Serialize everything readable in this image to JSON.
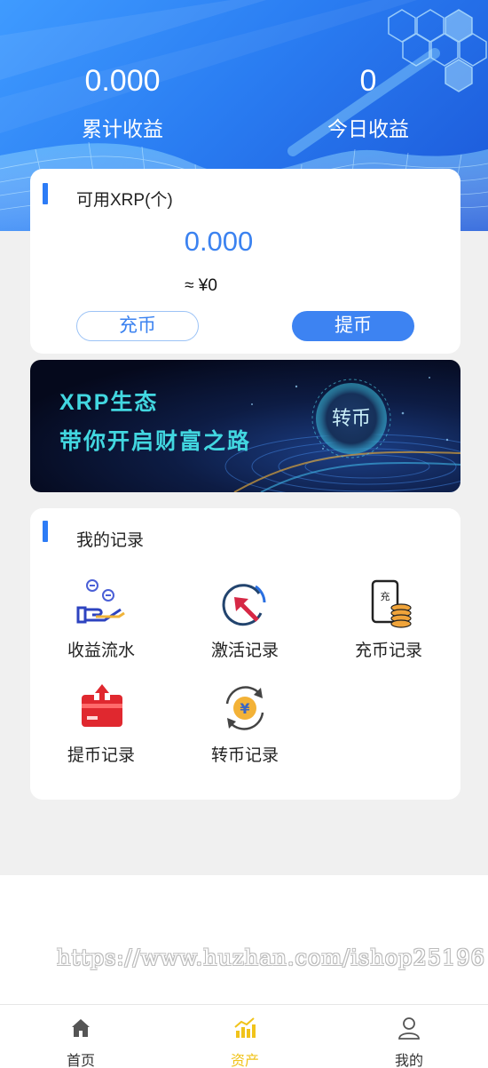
{
  "stats": {
    "total_value": "0.000",
    "total_label": "累计收益",
    "today_value": "0",
    "today_label": "今日收益"
  },
  "wallet": {
    "title": "可用XRP(个)",
    "amount": "0.000",
    "approx": "≈ ¥0",
    "recharge_label": "充币",
    "withdraw_label": "提币"
  },
  "banner": {
    "line1": "XRP生态",
    "line2": "带你开启财富之路",
    "button_label": "转币"
  },
  "records": {
    "title": "我的记录",
    "items": [
      {
        "label": "收益流水",
        "icon": "income-hand-icon"
      },
      {
        "label": "激活记录",
        "icon": "activation-arrow-icon"
      },
      {
        "label": "充币记录",
        "icon": "recharge-phone-icon"
      },
      {
        "label": "提币记录",
        "icon": "withdraw-card-icon"
      },
      {
        "label": "转币记录",
        "icon": "transfer-yuan-icon"
      }
    ]
  },
  "watermark": "https://www.huzhan.com/ishop25196",
  "tabbar": {
    "items": [
      {
        "label": "首页",
        "icon": "home-icon"
      },
      {
        "label": "资产",
        "icon": "assets-chart-icon"
      },
      {
        "label": "我的",
        "icon": "user-icon"
      }
    ],
    "active_color": "#f1c31a"
  },
  "colors": {
    "accent": "#3d83f2",
    "banner_text": "#42d7e0"
  }
}
